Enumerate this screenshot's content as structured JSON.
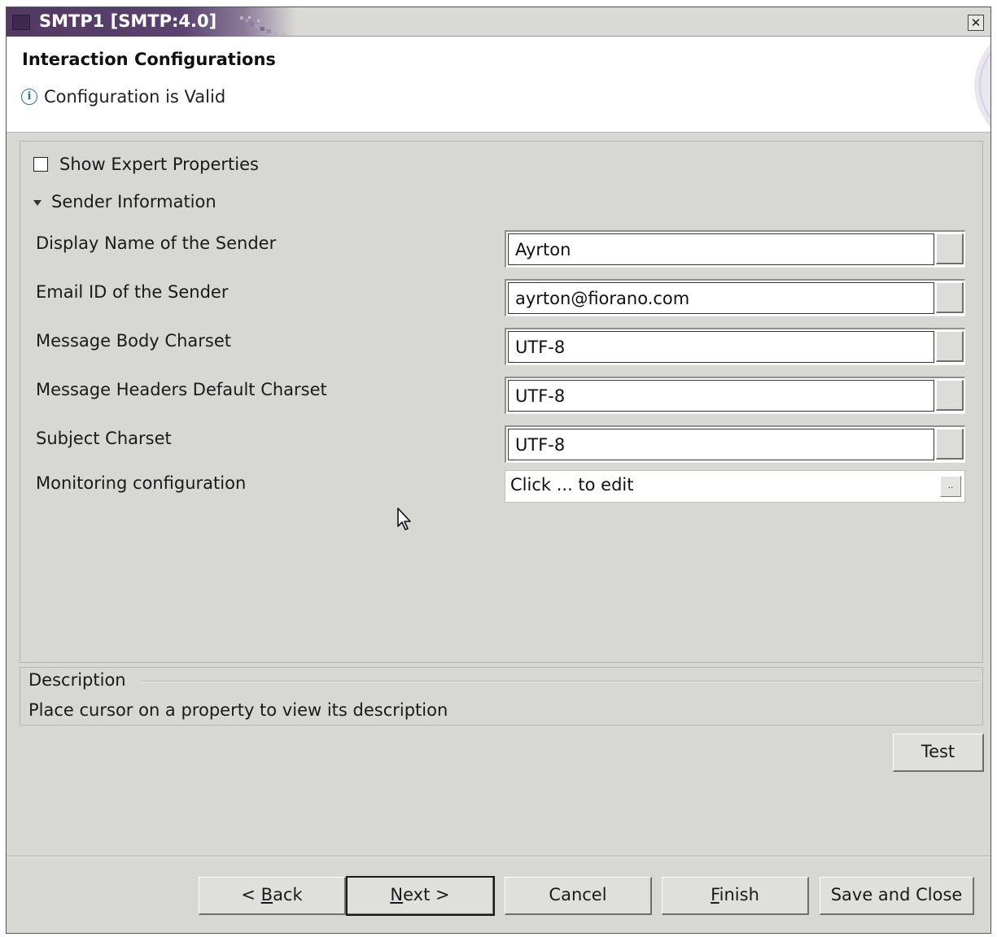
{
  "window": {
    "title": "SMTP1 [SMTP:4.0]",
    "close_symbol": "✕"
  },
  "header": {
    "heading": "Interaction Configurations",
    "status_icon": "info-icon",
    "status_icon_glyph": "i",
    "status_text": "Configuration is Valid"
  },
  "properties": {
    "expert_checkbox_label": "Show Expert Properties",
    "expert_checked": false,
    "section_title": "Sender Information",
    "rows": [
      {
        "label": "Display Name of the Sender",
        "value": "Ayrton"
      },
      {
        "label": "Email ID of the Sender",
        "value": "ayrton@fiorano.com"
      },
      {
        "label": "Message Body Charset",
        "value": "UTF-8"
      },
      {
        "label": "Message Headers Default Charset",
        "value": "UTF-8"
      },
      {
        "label": "Subject Charset",
        "value": "UTF-8"
      },
      {
        "label": "Monitoring configuration",
        "value": "Click ... to edit",
        "button_label": ".."
      }
    ]
  },
  "description": {
    "legend": "Description",
    "text": "Place cursor on a property to view its description"
  },
  "buttons": {
    "test": "Test",
    "back_prefix": "< ",
    "back_mnemonic": "B",
    "back_rest": "ack",
    "next_mnemonic": "N",
    "next_rest": "ext >",
    "cancel": "Cancel",
    "finish_mnemonic": "F",
    "finish_rest": "inish",
    "save_close": "Save and Close"
  },
  "colors": {
    "title_bar": "#523a63",
    "dialog_bg": "#d7d7d3",
    "info_icon": "#2a6fb0"
  }
}
